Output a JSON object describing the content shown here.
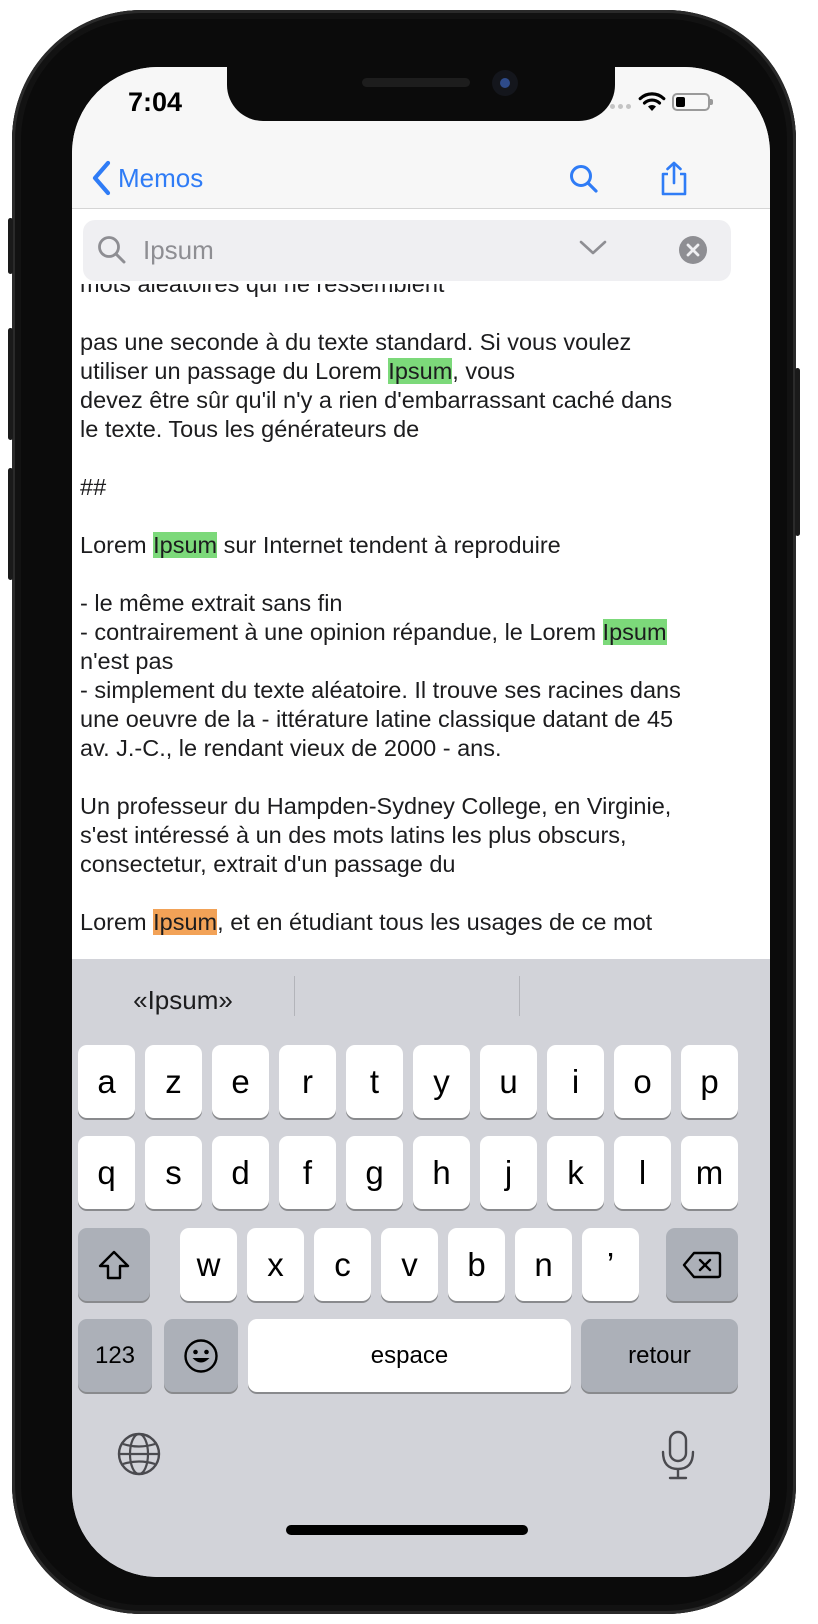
{
  "status_bar": {
    "time": "7:04"
  },
  "nav_bar": {
    "back_label": "Memos",
    "icons": [
      "chevron-left-icon",
      "search-icon",
      "share-icon"
    ],
    "accent_color": "#2f7cf6"
  },
  "search": {
    "value": "Ipsum",
    "icons": [
      "search-icon",
      "chevron-down-icon",
      "clear-icon"
    ]
  },
  "content": {
    "highlight_color": "#7cd97a",
    "current_match_color": "#f2a257",
    "lines": {
      "l0": "mots aléatoires qui ne ressemblent",
      "l1a": "pas une seconde à du texte standard. Si vous voulez",
      "l2a": "utiliser un passage du Lorem ",
      "l2h": "Ipsum",
      "l2b": ", vous",
      "l3": "devez être sûr qu'il n'y a rien d'embarrassant caché dans",
      "l4": "le texte. Tous les générateurs de",
      "l5": "##",
      "l6a": "Lorem ",
      "l6h": "Ipsum",
      "l6b": " sur Internet tendent à reproduire",
      "l7": "- le même extrait sans fin",
      "l8a": "- contrairement à une opinion répandue, le Lorem ",
      "l8h": "Ipsum",
      "l9": "n'est pas",
      "l10": "- simplement du texte aléatoire. Il trouve ses racines dans",
      "l11": "une oeuvre de la - ittérature latine classique datant de 45",
      "l12": "av. J.-C., le rendant vieux de 2000 - ans.",
      "l13": "Un professeur du Hampden-Sydney College, en Virginie,",
      "l14": "s'est intéressé à un des mots latins les plus obscurs,",
      "l15": "consectetur, extrait d'un passage du",
      "l16a": "Lorem ",
      "l16h": "Ipsum",
      "l16b": ", et en étudiant tous les usages de ce mot"
    }
  },
  "keyboard": {
    "suggestions": [
      "«Ipsum»",
      "",
      ""
    ],
    "row1": [
      "a",
      "z",
      "e",
      "r",
      "t",
      "y",
      "u",
      "i",
      "o",
      "p"
    ],
    "row2": [
      "q",
      "s",
      "d",
      "f",
      "g",
      "h",
      "j",
      "k",
      "l",
      "m"
    ],
    "row3": [
      "w",
      "x",
      "c",
      "v",
      "b",
      "n",
      "’"
    ],
    "numbers_label": "123",
    "space_label": "espace",
    "return_label": "retour",
    "icons": [
      "shift-icon",
      "delete-icon",
      "emoji-icon",
      "globe-icon",
      "microphone-icon"
    ]
  }
}
